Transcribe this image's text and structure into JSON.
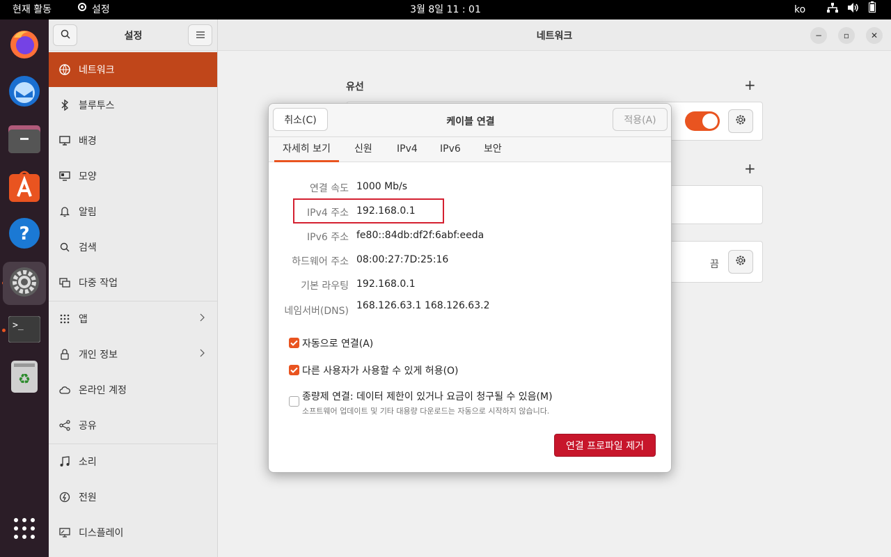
{
  "topbar": {
    "activities": "현재 활동",
    "app_name": "설정",
    "clock": "3월 8일  11 : 01",
    "lang": "ko"
  },
  "dock": {
    "items": [
      "firefox-icon",
      "thunderbird-icon",
      "files-icon",
      "app-center-icon",
      "help-icon",
      "settings-icon",
      "terminal-icon",
      "trash-icon",
      "show-apps-icon"
    ]
  },
  "sidebar": {
    "title": "설정",
    "items": [
      {
        "label": "네트워크",
        "icon": "network-icon"
      },
      {
        "label": "블루투스",
        "icon": "bluetooth-icon"
      },
      {
        "label": "배경",
        "icon": "background-icon"
      },
      {
        "label": "모양",
        "icon": "appearance-icon"
      },
      {
        "label": "알림",
        "icon": "bell-icon"
      },
      {
        "label": "검색",
        "icon": "search-icon"
      },
      {
        "label": "다중 작업",
        "icon": "multitasking-icon"
      },
      {
        "label": "앱",
        "icon": "apps-icon"
      },
      {
        "label": "개인 정보",
        "icon": "lock-icon"
      },
      {
        "label": "온라인 계정",
        "icon": "cloud-icon"
      },
      {
        "label": "공유",
        "icon": "share-icon"
      },
      {
        "label": "소리",
        "icon": "music-icon"
      },
      {
        "label": "전원",
        "icon": "power-icon"
      },
      {
        "label": "디스플레이",
        "icon": "display-icon"
      }
    ]
  },
  "main": {
    "title": "네트워크",
    "wired_section": "유선",
    "proxy_status": "끔"
  },
  "dialog": {
    "cancel": "취소(C)",
    "title": "케이블 연결",
    "apply": "적용(A)",
    "tabs": [
      "자세히 보기",
      "신원",
      "IPv4",
      "IPv6",
      "보안"
    ],
    "active_tab": "자세히 보기",
    "details": [
      {
        "label": "연결 속도",
        "value": "1000 Mb/s"
      },
      {
        "label": "IPv4 주소",
        "value": "192.168.0.1"
      },
      {
        "label": "IPv6 주소",
        "value": "fe80::84db:df2f:6abf:eeda"
      },
      {
        "label": "하드웨어 주소",
        "value": "08:00:27:7D:25:16"
      },
      {
        "label": "기본 라우팅",
        "value": "192.168.0.1"
      },
      {
        "label": "네임서버(DNS)",
        "value": "168.126.63.1 168.126.63.2"
      }
    ],
    "auto_connect": "자동으로 연결(A)",
    "allow_others": "다른 사용자가 사용할 수 있게 허용(O)",
    "metered": "종량제 연결: 데이터 제한이 있거나 요금이 청구될 수 있음(M)",
    "metered_sub": "소프트웨어 업데이트 및 기타 대용량 다운로드는 자동으로 시작하지 않습니다.",
    "remove": "연결 프로파일 제거"
  },
  "colors": {
    "accent": "#e95420",
    "sidebar_active": "#c0461a",
    "destructive": "#c7162b",
    "highlight_box": "#d42030"
  }
}
